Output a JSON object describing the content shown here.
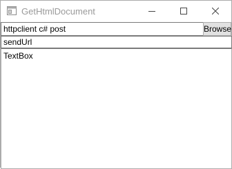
{
  "window": {
    "title": "GetHtmlDocument",
    "icons": {
      "app": "window-app-icon",
      "minimize": "minimize-icon",
      "maximize": "maximize-icon",
      "close": "close-icon"
    }
  },
  "toolbar": {
    "url_value": "httpclient c# post",
    "browse_label": "Browse"
  },
  "send_box": {
    "text": "sendUrl"
  },
  "text_box": {
    "text": "TextBox"
  }
}
